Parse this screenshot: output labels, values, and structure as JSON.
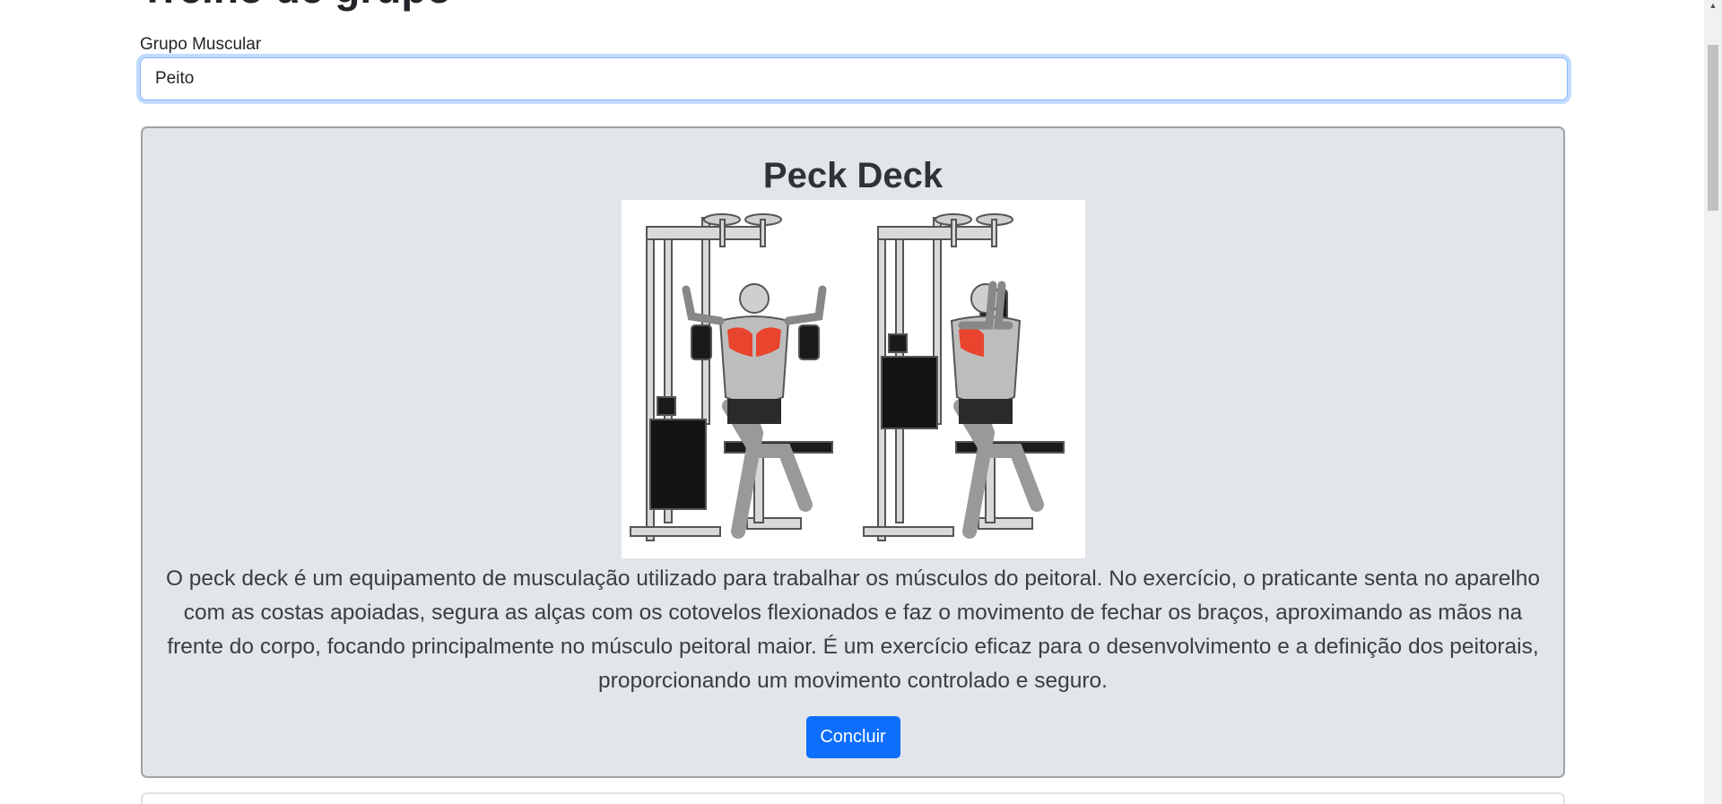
{
  "page": {
    "heading": "Treino de grupo"
  },
  "filter": {
    "label": "Grupo Muscular",
    "selected": "Peito"
  },
  "exercise": {
    "title": "Peck Deck",
    "image_alt": "Peck deck machine illustration",
    "description": "O peck deck é um equipamento de musculação utilizado para trabalhar os músculos do peitoral. No exercício, o praticante senta no aparelho com as costas apoiadas, segura as alças com os cotovelos flexionados e faz o movimento de fechar os braços, aproximando as mãos na frente do corpo, focando principalmente no músculo peitoral maior. É um exercício eficaz para o desenvolvimento e a definição dos peitorais, proporcionando um movimento controlado e seguro.",
    "button_label": "Concluir"
  },
  "colors": {
    "accent": "#0d6efd",
    "card_background": "#e2e5e9",
    "muscle_highlight": "#e8442e"
  },
  "icons": {
    "scroll_up": "caret-up-icon"
  }
}
